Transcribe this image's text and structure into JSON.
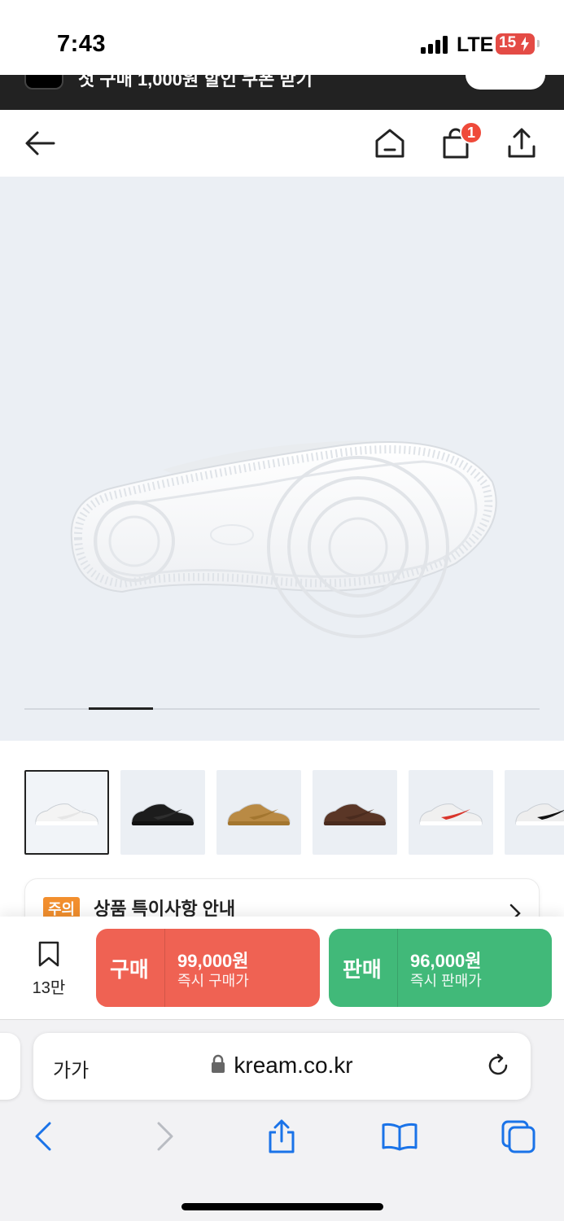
{
  "status_bar": {
    "time": "7:43",
    "network": "LTE",
    "battery": "15"
  },
  "promo": {
    "text": "첫 구매 1,000원 할인 쿠폰 받기"
  },
  "header": {
    "cart_count": "1",
    "icons": [
      "back-arrow-icon",
      "home-icon",
      "shopping-bag-icon",
      "share-icon"
    ]
  },
  "gallery": {
    "active_index": 1,
    "thumbnails": [
      {
        "name": "white",
        "color": "#f4f4f4",
        "accent": "#e6e6e6"
      },
      {
        "name": "black",
        "color": "#1c1c1c",
        "accent": "#2e2e2e"
      },
      {
        "name": "wheat",
        "color": "#b98a44",
        "accent": "#a3762f"
      },
      {
        "name": "brown",
        "color": "#5a3626",
        "accent": "#4a2b1e"
      },
      {
        "name": "red-paisley",
        "color": "#f0f0f0",
        "accent": "#d9352b"
      },
      {
        "name": "white-black",
        "color": "#eeeeee",
        "accent": "#111111"
      }
    ]
  },
  "notice": {
    "tag": "주의",
    "title": "상품 특이사항 안내"
  },
  "actions": {
    "wish_count": "13만",
    "buy": {
      "kind": "구매",
      "price": "99,000원",
      "sub": "즉시 구매가"
    },
    "sell": {
      "kind": "판매",
      "price": "96,000원",
      "sub": "즉시 판매가"
    }
  },
  "browser": {
    "text_size_label": "가가",
    "url": "kream.co.kr"
  },
  "colors": {
    "buy": "#ef6253",
    "sell": "#41b979",
    "badge": "#ef4a3a",
    "notice_tag": "#f28f2e"
  }
}
